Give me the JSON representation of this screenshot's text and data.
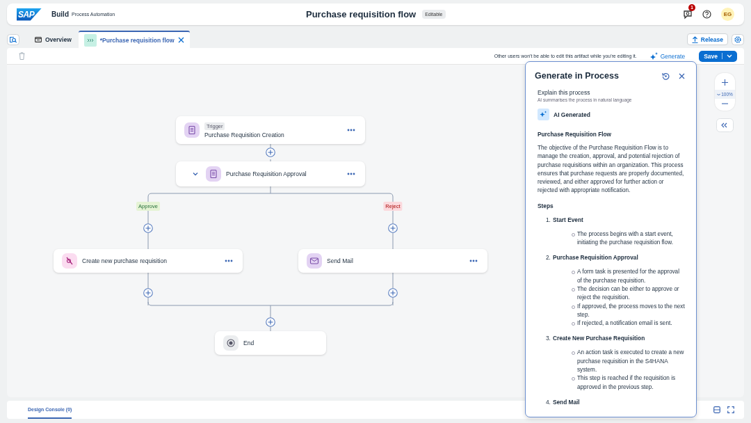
{
  "header": {
    "logo": "SAP",
    "product": "Build",
    "subtitle": "Process Automation",
    "title": "Purchase requisition flow",
    "badge": "Editable",
    "notification_count": "1",
    "avatar": "EG"
  },
  "tabs": [
    {
      "kind": "overview",
      "label": "Overview",
      "selected": false
    },
    {
      "kind": "process",
      "label": "*Purchase requisition flow",
      "selected": true
    }
  ],
  "release_button": "Release",
  "toolbar": {
    "notice": "Other users won't be able to edit this artifact while you're editing it.",
    "generate": "Generate",
    "save": "Save"
  },
  "flow": {
    "nodes": [
      {
        "kind": "trigger",
        "tag": "Trigger",
        "label": "Purchase Requisition Creation"
      },
      {
        "kind": "approval",
        "label": "Purchase Requisition Approval",
        "expanded": true
      },
      {
        "kind": "action",
        "label": "Create new purchase requisition"
      },
      {
        "kind": "mail",
        "label": "Send Mail"
      },
      {
        "kind": "end",
        "label": "End"
      }
    ],
    "branches": [
      {
        "label": "Approve",
        "color": "#e5f3d4"
      },
      {
        "label": "Reject",
        "color": "#fbd9dd"
      }
    ]
  },
  "zoom": "100%",
  "panel": {
    "title": "Generate in Process",
    "prompt": "Explain this process",
    "prompt_hint": "AI summarises the process in natural language",
    "badge": "AI Generated",
    "heading": "Purchase Requisition Flow",
    "paragraph": "The objective of the Purchase Requisition Flow is to manage the creation, approval, and potential rejection of purchase requisitions within an organization. This process ensures that purchase requests are properly documented, reviewed, and either approved for further action or rejected with appropriate notification.",
    "steps_heading": "Steps",
    "steps": [
      {
        "number": "1.",
        "title": "Start Event",
        "bullets": [
          "The process begins with a start event, initiating the purchase requisition flow."
        ]
      },
      {
        "number": "2.",
        "title": "Purchase Requisition Approval",
        "bullets": [
          "A form task is presented for the approval of the purchase requisition.",
          "The decision can be either to approve or reject the requisition.",
          "If approved, the process moves to the next step.",
          "If rejected, a notification email is sent."
        ]
      },
      {
        "number": "3.",
        "title": "Create New Purchase Requisition",
        "bullets": [
          "An action task is executed to create a new purchase requisition in the S4HANA system.",
          "This step is reached if the requisition is approved in the previous step."
        ]
      },
      {
        "number": "4.",
        "title": "Send Mail"
      }
    ]
  },
  "bottom_tabs": [
    {
      "label": "Design Console (0)",
      "selected": true
    }
  ]
}
